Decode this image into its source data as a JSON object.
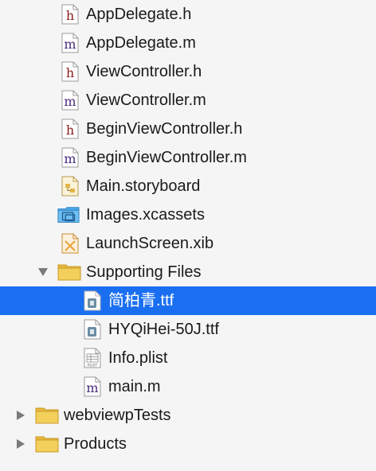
{
  "navigator": {
    "items": [
      {
        "label": "AppDelegate.h",
        "icon": "header-file-icon"
      },
      {
        "label": "AppDelegate.m",
        "icon": "objc-source-file-icon"
      },
      {
        "label": "ViewController.h",
        "icon": "header-file-icon"
      },
      {
        "label": "ViewController.m",
        "icon": "objc-source-file-icon"
      },
      {
        "label": "BeginViewController.h",
        "icon": "header-file-icon"
      },
      {
        "label": "BeginViewController.m",
        "icon": "objc-source-file-icon"
      },
      {
        "label": "Main.storyboard",
        "icon": "storyboard-icon"
      },
      {
        "label": "Images.xcassets",
        "icon": "asset-catalog-icon"
      },
      {
        "label": "LaunchScreen.xib",
        "icon": "xib-file-icon"
      },
      {
        "label": "Supporting Files",
        "icon": "folder-icon",
        "expanded": true
      },
      {
        "label": "简柏青.ttf",
        "icon": "font-file-icon",
        "selected": true
      },
      {
        "label": "HYQiHei-50J.ttf",
        "icon": "font-file-icon"
      },
      {
        "label": "Info.plist",
        "icon": "plist-file-icon",
        "badge": "PLIST"
      },
      {
        "label": "main.m",
        "icon": "objc-source-file-icon"
      },
      {
        "label": "webviewpTests",
        "icon": "folder-icon",
        "expanded": false
      },
      {
        "label": "Products",
        "icon": "folder-icon",
        "expanded": false
      }
    ],
    "icon_letters": {
      "header": "h",
      "source": "m"
    },
    "colors": {
      "selection": "#1a6ff1",
      "header_letter": "#8b1a1a",
      "source_letter": "#4a2b7a",
      "folder": "#f0c94f",
      "asset_catalog": "#4aa6e8",
      "xib": "#e8a43a",
      "background": "#f5f5f6"
    }
  }
}
